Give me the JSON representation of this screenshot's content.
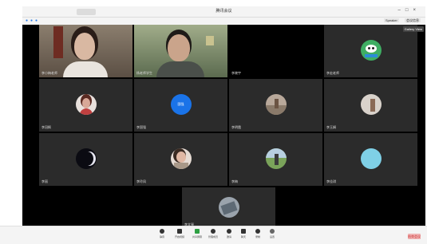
{
  "window": {
    "title": "腾讯会议"
  },
  "meeting_bar": {
    "right_labels": [
      "Speaker",
      "会议信息"
    ]
  },
  "gallery_badge": "Gallery View",
  "tiles": [
    {
      "name": "李小梅老师",
      "type": "video"
    },
    {
      "name": "杨老师学生",
      "type": "video"
    },
    {
      "name": "李晓宇",
      "type": "empty"
    },
    {
      "name": "李宏老师",
      "type": "avatar"
    },
    {
      "name": "李冠枫",
      "type": "avatar"
    },
    {
      "name": "李国强",
      "type": "avatar"
    },
    {
      "name": "李明霞",
      "type": "avatar"
    },
    {
      "name": "李玉娟",
      "type": "avatar"
    },
    {
      "name": "李丽",
      "type": "avatar"
    },
    {
      "name": "李玲凤",
      "type": "avatar"
    },
    {
      "name": "李梅",
      "type": "avatar"
    },
    {
      "name": "李佳琪",
      "type": "avatar"
    },
    {
      "name": "李文琴",
      "type": "avatar"
    }
  ],
  "controls": [
    "静音",
    "开启视频",
    "共享屏幕",
    "管理成员",
    "邀请",
    "聊天",
    "录制",
    "设置"
  ],
  "end_button": "结束会议",
  "colors": {
    "tile_bg": "#2b2b2b",
    "accent": "#2b7de9",
    "end": "#e64545"
  }
}
